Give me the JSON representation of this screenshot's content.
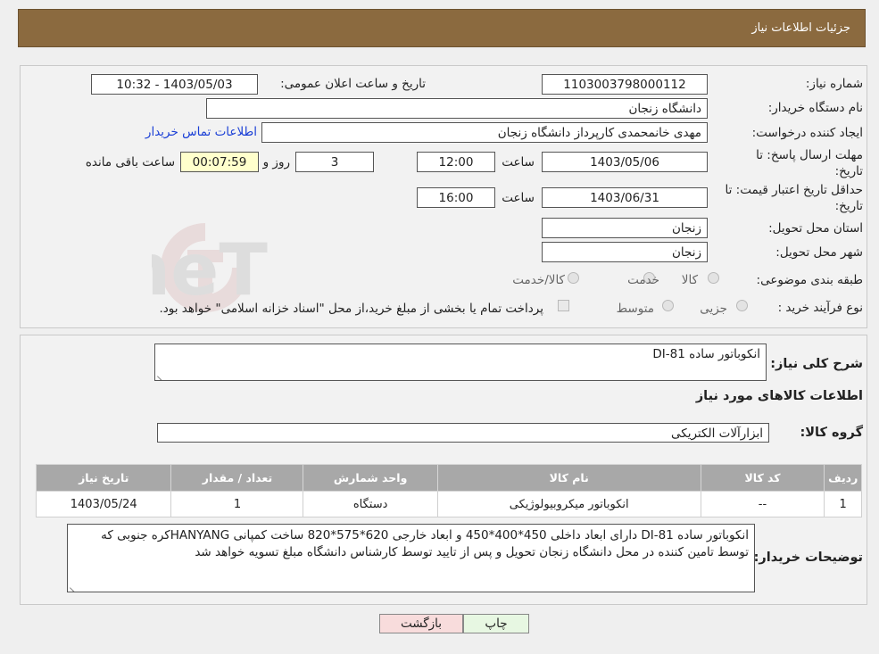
{
  "header": {
    "title": "جزئیات اطلاعات نیاز"
  },
  "form": {
    "need_number_label": "شماره نیاز:",
    "need_number": "1103003798000112",
    "announce_label": "تاریخ و ساعت اعلان عمومی:",
    "announce_value": "1403/05/03 - 10:32",
    "buyer_org_label": "نام دستگاه خریدار:",
    "buyer_org": "دانشگاه زنجان",
    "creator_label": "ایجاد کننده درخواست:",
    "creator": "مهدی خانمحمدی کارپرداز دانشگاه زنجان",
    "contact_link": "اطلاعات تماس خریدار",
    "deadline_label_1": "مهلت ارسال پاسخ: تا",
    "deadline_label_2": "تاریخ:",
    "deadline_date": "1403/05/06",
    "time_label": "ساعت",
    "deadline_time": "12:00",
    "days_value": "3",
    "days_label": "روز و",
    "remaining_value": "00:07:59",
    "remaining_label": "ساعت باقی مانده",
    "validity_label_1": "حداقل تاریخ اعتبار قیمت: تا",
    "validity_label_2": "تاریخ:",
    "validity_date": "1403/06/31",
    "validity_time": "16:00",
    "province_label": "استان محل تحویل:",
    "province": "زنجان",
    "city_label": "شهر محل تحویل:",
    "city": "زنجان",
    "category_label": "طبقه بندی موضوعی:",
    "category_options": [
      "کالا",
      "خدمت",
      "کالا/خدمت"
    ],
    "process_label": "نوع فرآیند خرید :",
    "process_options": [
      "جزیی",
      "متوسط"
    ],
    "payment_note": "پرداخت تمام یا بخشی از مبلغ خرید،از محل \"اسناد خزانه اسلامی\" خواهد بود."
  },
  "details": {
    "summary_label": "شرح کلی نیاز:",
    "summary": "انکوباتور ساده DI-81",
    "items_title": "اطلاعات کالاهای مورد نیاز",
    "group_label": "گروه کالا:",
    "group_value": "ابزارآلات الکتریکی",
    "table": {
      "headers": [
        "ردیف",
        "کد کالا",
        "نام کالا",
        "واحد شمارش",
        "تعداد / مقدار",
        "تاریخ نیاز"
      ],
      "rows": [
        [
          "1",
          "--",
          "انکوباتور میکروبیولوژیکی",
          "دستگاه",
          "1",
          "1403/05/24"
        ]
      ]
    },
    "buyer_notes_label": "توضیحات خریدار:",
    "buyer_notes": "انکوباتور ساده DI-81 دارای ابعاد داخلی 450*400*450 و ابعاد خارجی 620*575*820 ساخت کمپانی HANYANGکره جنوبی که توسط تامین کننده در محل دانشگاه زنجان تحویل و پس از تایید توسط کارشناس دانشگاه مبلغ تسویه خواهد شد"
  },
  "buttons": {
    "print": "چاپ",
    "back": "بازگشت"
  },
  "colors": {
    "header_bg": "#8b6a3f",
    "table_header_bg": "#a8a8a8",
    "link": "#1a3fd6",
    "timer_bg": "#ffffcc",
    "back_bg": "#f8dcdc"
  },
  "watermark": "AriaTender.neT"
}
